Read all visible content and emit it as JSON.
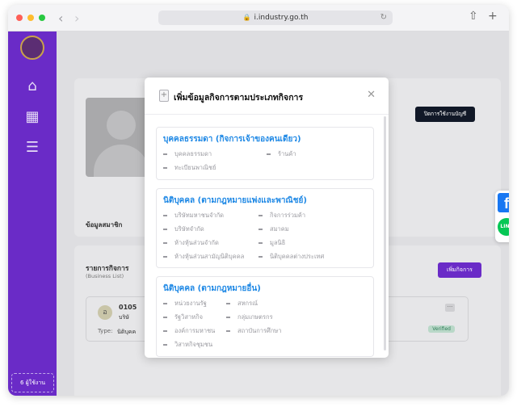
{
  "browser": {
    "url": "i.industry.go.th"
  },
  "sidebar": {
    "footer": "6  ผู้ใช้งาน"
  },
  "profile": {
    "manage_label": "ปิดการใช้งานบัญชี",
    "member_label": "ข้อมูลสมาชิก"
  },
  "business": {
    "title": "รายการกิจการ",
    "subtitle": "(Business List)",
    "add_label": "เพิ่มกิจการ",
    "item_icon": "อ",
    "item_line1": "0105",
    "item_line2": "บริษั",
    "type_label": "Type:",
    "type_value": "นิติบุคค",
    "status": "Verified",
    "more": "···"
  },
  "modal": {
    "title": "เพิ่มข้อมูลกิจการตามประเภทกิจการ",
    "sections": [
      {
        "title": "บุคคลธรรมดา (กิจการเจ้าของคนเดียว)",
        "items": [
          "บุคคลธรรมดา",
          "ร้านค้า",
          "ทะเบียนพาณิชย์"
        ]
      },
      {
        "title": "นิติบุคคล (ตามกฎหมายแพ่งและพาณิชย์)",
        "items": [
          "บริษัทมหาชนจำกัด",
          "กิจการร่วมค้า",
          "บริษัทจำกัด",
          "สมาคม",
          "ห้างหุ้นส่วนจำกัด",
          "มูลนิธิ",
          "ห้างหุ้นส่วนสามัญนิติบุคคล",
          "นิติบุคคลต่างประเทศ"
        ]
      },
      {
        "title": "นิติบุคคล (ตามกฎหมายอื่น)",
        "items": [
          "หน่วยงานรัฐ",
          "สหกรณ์",
          "รัฐวิสาหกิจ",
          "กลุ่มเกษตรกร",
          "องค์การมหาชน",
          "สถาบันการศึกษา",
          "วิสาหกิจชุมชน"
        ]
      }
    ]
  },
  "support": {
    "line_label": "LINE",
    "fb_label": "f"
  },
  "colors": {
    "sidebar": "#6a2bc7",
    "accent": "#1e88e5",
    "verified": "#2e7d57"
  }
}
